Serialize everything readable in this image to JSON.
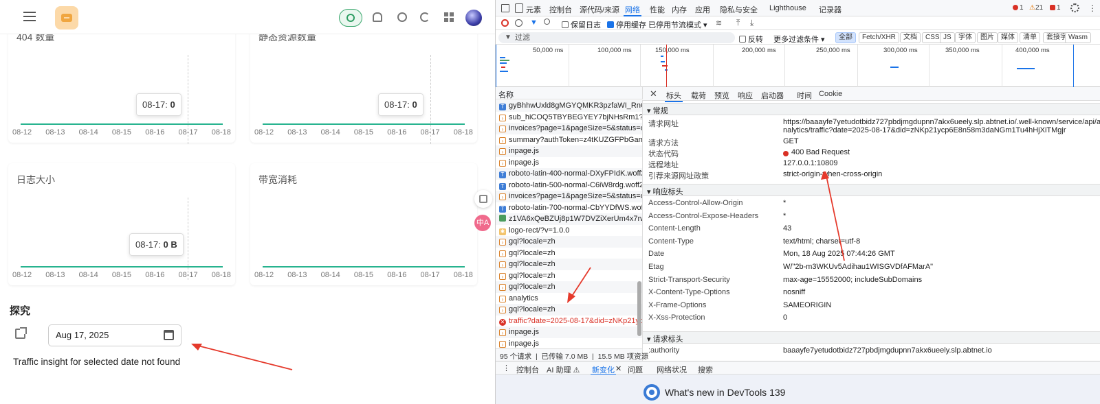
{
  "app": {
    "cards": [
      {
        "title": "404 数量",
        "tooltip_date": "08-17:",
        "tooltip_value": "0"
      },
      {
        "title": "静态资源数量",
        "tooltip_date": "08-17:",
        "tooltip_value": "0"
      },
      {
        "title": "日志大小",
        "tooltip_date": "08-17:",
        "tooltip_value": "0 B"
      },
      {
        "title": "带宽消耗",
        "tooltip_date": "",
        "tooltip_value": ""
      }
    ],
    "x_ticks": [
      "08-12",
      "08-13",
      "08-14",
      "08-15",
      "08-16",
      "08-17",
      "08-18"
    ],
    "explore_title": "探究",
    "date_value": "Aug 17, 2025",
    "not_found_text": "Traffic insight for selected date not found",
    "float_translate": "中A",
    "accent_color": "#27b38f"
  },
  "devtools": {
    "tabs": [
      "元素",
      "控制台",
      "源代码/来源",
      "网络",
      "性能",
      "内存",
      "应用",
      "隐私与安全",
      "Lighthouse",
      "记录器"
    ],
    "active_tab": "网络",
    "badges": {
      "errors": "1",
      "warnings": "21",
      "issues": "1"
    },
    "toolbar": {
      "preserve_log": "保留日志",
      "disable_cache": "停用缓存",
      "throttle": "已停用节流模式"
    },
    "filter": {
      "placeholder": "过滤",
      "invert": "反转",
      "more_filters": "更多过滤条件",
      "chips": [
        "全部",
        "Fetch/XHR",
        "文档",
        "CSS",
        "JS",
        "字体",
        "图片",
        "媒体",
        "清单",
        "套接字",
        "Wasm"
      ]
    },
    "timeline_labels": [
      "50,000 ms",
      "100,000 ms",
      "150,000 ms",
      "200,000 ms",
      "250,000 ms",
      "300,000 ms",
      "350,000 ms",
      "400,000 ms"
    ],
    "names_header": "名称",
    "requests": [
      {
        "type": "doc",
        "name": "gyBhhwUxld8gMGYQMKR3pzfaWI_RnOMI..."
      },
      {
        "type": "js",
        "name": "sub_hiCOQ5TBYBEGYEY7bjNHsRm1?authT..."
      },
      {
        "type": "js",
        "name": "invoices?page=1&pageSize=5&status=op..."
      },
      {
        "type": "js",
        "name": "summary?authToken=z4tKUZGFPbGamCqi..."
      },
      {
        "type": "js",
        "name": "inpage.js"
      },
      {
        "type": "js",
        "name": "inpage.js"
      },
      {
        "type": "doc",
        "name": "roboto-latin-400-normal-DXyFPIdK.woff2"
      },
      {
        "type": "doc",
        "name": "roboto-latin-500-normal-C6iW8rdg.woff2"
      },
      {
        "type": "js",
        "name": "invoices?page=1&pageSize=5&status=op..."
      },
      {
        "type": "doc",
        "name": "roboto-latin-700-normal-CbYYDfWS.woff2"
      },
      {
        "type": "img",
        "name": "z1VA6xQeBZUj8p1W7DVZiXerUm4x7rwm..."
      },
      {
        "type": "star",
        "name": "logo-rect/?v=1.0.0"
      },
      {
        "type": "js",
        "name": "gql?locale=zh"
      },
      {
        "type": "js",
        "name": "gql?locale=zh"
      },
      {
        "type": "js",
        "name": "gql?locale=zh"
      },
      {
        "type": "js",
        "name": "gql?locale=zh"
      },
      {
        "type": "js",
        "name": "gql?locale=zh"
      },
      {
        "type": "js",
        "name": "analytics"
      },
      {
        "type": "js",
        "name": "gql?locale=zh"
      },
      {
        "type": "err",
        "name": "traffic?date=2025-08-17&did=zNKp21ycp..."
      },
      {
        "type": "js",
        "name": "inpage.js"
      },
      {
        "type": "js",
        "name": "inpage.js"
      }
    ],
    "summary": {
      "requests": "95 个请求",
      "transferred": "已传输 7.0 MB",
      "resources": "15.5 MB 项资源"
    },
    "detail_tabs": [
      "标头",
      "载荷",
      "预览",
      "响应",
      "启动器",
      "时间",
      "Cookie"
    ],
    "general": {
      "section": "常规",
      "rows": [
        {
          "k": "请求网址",
          "v": "https://baaayfe7yetudotbidz727pbdjmgdupnn7akx6ueely.slp.abtnet.io/.well-known/service/api/a",
          "v2": "nalytics/traffic?date=2025-08-17&did=zNKp21ycp6E8n58m3daNGm1Tu4hHjXiTMgjr"
        },
        {
          "k": "请求方法",
          "v": "GET"
        },
        {
          "k": "状态代码",
          "v": "400 Bad Request"
        },
        {
          "k": "远程地址",
          "v": "127.0.0.1:10809"
        },
        {
          "k": "引荐来源网址政策",
          "v": "strict-origin-when-cross-origin"
        }
      ]
    },
    "response_headers": {
      "section": "响应标头",
      "rows": [
        {
          "k": "Access-Control-Allow-Origin",
          "v": "*"
        },
        {
          "k": "Access-Control-Expose-Headers",
          "v": "*"
        },
        {
          "k": "Content-Length",
          "v": "43"
        },
        {
          "k": "Content-Type",
          "v": "text/html; charset=utf-8"
        },
        {
          "k": "Date",
          "v": "Mon, 18 Aug 2025 07:44:26 GMT"
        },
        {
          "k": "Etag",
          "v": "W/\"2b-m3WKUv5Adihau1WISGVDfAFMarA\""
        },
        {
          "k": "Strict-Transport-Security",
          "v": "max-age=15552000; includeSubDomains"
        },
        {
          "k": "X-Content-Type-Options",
          "v": "nosniff"
        },
        {
          "k": "X-Frame-Options",
          "v": "SAMEORIGIN"
        },
        {
          "k": "X-Xss-Protection",
          "v": "0"
        }
      ]
    },
    "request_headers": {
      "section": "请求标头",
      "rows": [
        {
          "k": ":authority",
          "v": "baaayfe7yetudotbidz727pbdjmgdupnn7akx6ueely.slp.abtnet.io"
        }
      ]
    },
    "drawer_tabs": [
      "控制台",
      "AI 助理 ⚠",
      "新变化",
      "问题",
      "网络状况",
      "搜索"
    ],
    "drawer_active": "新变化",
    "whats_new": "What's new in DevTools 139",
    "status_error_color": "#d93025",
    "active_color": "#1a73e8"
  }
}
